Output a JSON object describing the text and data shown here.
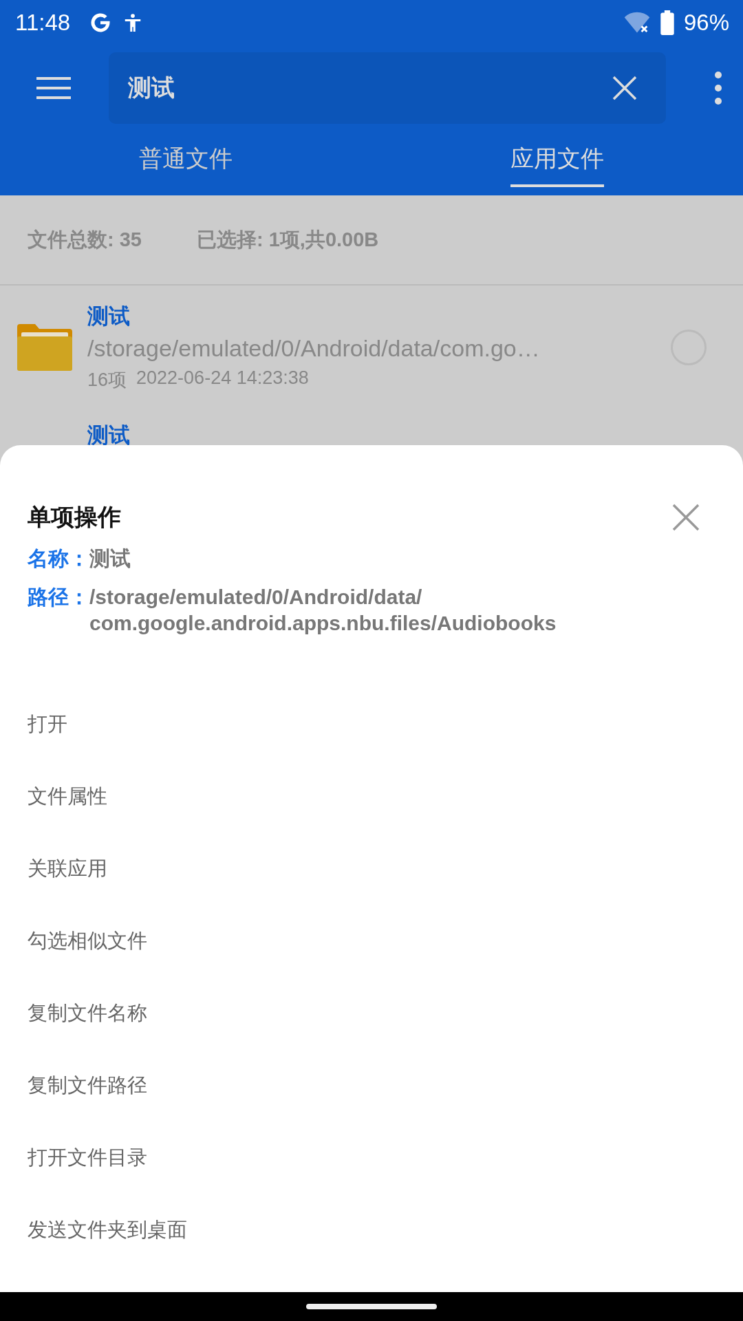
{
  "status_bar": {
    "time": "11:48",
    "battery": "96%"
  },
  "search": {
    "value": "测试"
  },
  "tabs": [
    {
      "label": "普通文件",
      "selected": false
    },
    {
      "label": "应用文件",
      "selected": true
    }
  ],
  "summary": {
    "total": "文件总数: 35",
    "selected": "已选择: 1项,共0.00B"
  },
  "files": [
    {
      "name": "测试",
      "path": "/storage/emulated/0/Android/data/com.go…",
      "count": "16项",
      "date": "2022-06-24 14:23:38",
      "checked": false
    },
    {
      "name": "测试"
    }
  ],
  "sheet": {
    "title": "单项操作",
    "name_label": "名称：",
    "name": "测试",
    "path_label": "路径：",
    "path": "/storage/emulated/0/Android/data/\ncom.google.android.apps.nbu.files/Audiobooks",
    "actions": [
      "打开",
      "文件属性",
      "关联应用",
      "勾选相似文件",
      "复制文件名称",
      "复制文件路径",
      "打开文件目录",
      "发送文件夹到桌面"
    ]
  }
}
